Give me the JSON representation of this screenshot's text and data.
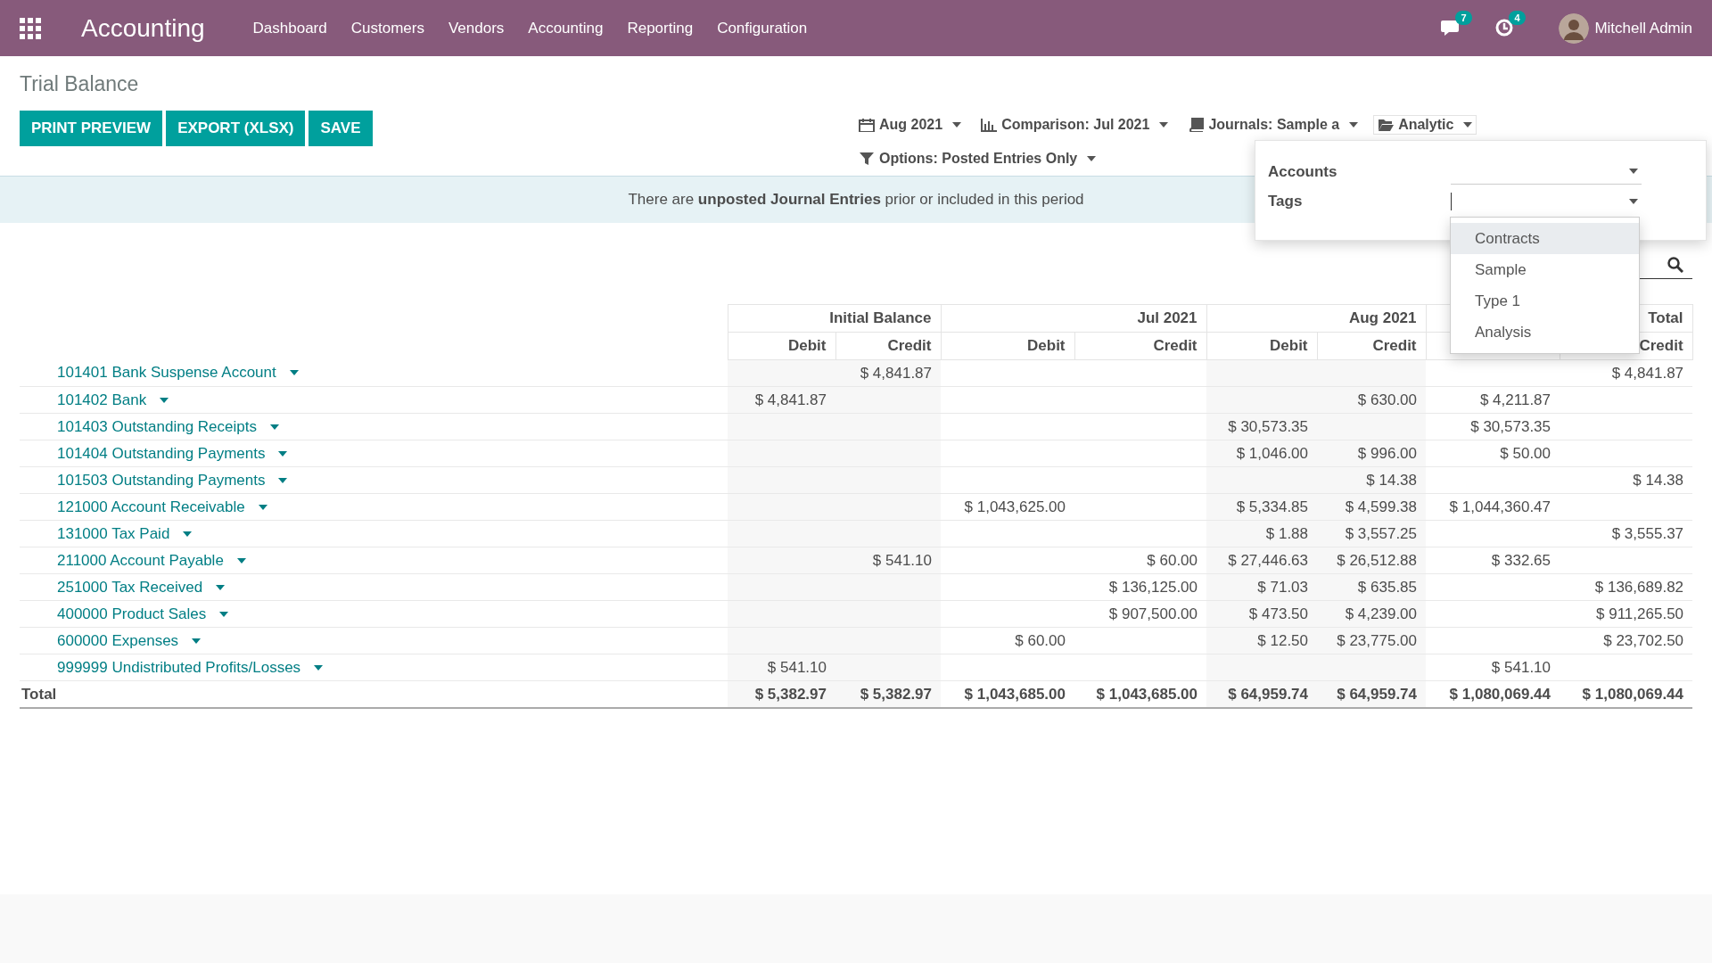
{
  "navbar": {
    "app_name": "Accounting",
    "menu": [
      "Dashboard",
      "Customers",
      "Vendors",
      "Accounting",
      "Reporting",
      "Configuration"
    ],
    "messages_count": "7",
    "activities_count": "4",
    "user": "Mitchell Admin"
  },
  "title": "Trial Balance",
  "buttons": [
    "PRINT PREVIEW",
    "EXPORT (XLSX)",
    "SAVE"
  ],
  "filters": [
    {
      "kind": "calendar",
      "label": "Aug 2021"
    },
    {
      "kind": "chart",
      "label": "Comparison: Jul 2021"
    },
    {
      "kind": "book",
      "label": "Journals: Sample a"
    },
    {
      "kind": "folder",
      "label": "Analytic",
      "expanded": true
    },
    {
      "kind": "funnel",
      "label": "Options: Posted Entries Only"
    }
  ],
  "banner": "There are **unposted Journal Entries** prior or included in this period",
  "analytic_panel": {
    "fields": [
      {
        "label": "Accounts",
        "focused": false
      },
      {
        "label": "Tags",
        "focused": true
      }
    ],
    "options": [
      {
        "label": "Contracts",
        "selected": true
      },
      {
        "label": "Sample",
        "selected": false
      },
      {
        "label": "Type 1",
        "selected": false
      },
      {
        "label": "Analysis",
        "selected": false
      }
    ]
  },
  "table": {
    "groups": [
      {
        "label": "Initial Balance",
        "columns": [
          "Debit",
          "Credit"
        ]
      },
      {
        "label": "Jul 2021",
        "columns": [
          "Debit",
          "Credit"
        ]
      },
      {
        "label": "Aug 2021",
        "columns": [
          "Debit",
          "Credit"
        ]
      },
      {
        "label": "Total",
        "columns": [
          "Credit"
        ]
      }
    ],
    "rows": [
      {
        "account": "101401 Bank Suspense Account",
        "values": {
          "initial_credit": "$ 4,841.87",
          "total_credit": "$ 4,841.87"
        }
      },
      {
        "account": "101402 Bank",
        "values": {
          "initial_debit": "$ 4,841.87",
          "aug_credit": "$ 630.00",
          "total_debit": "$ 4,211.87"
        }
      },
      {
        "account": "101403 Outstanding Receipts",
        "values": {
          "aug_debit": "$ 30,573.35",
          "total_debit": "$ 30,573.35"
        }
      },
      {
        "account": "101404 Outstanding Payments",
        "values": {
          "aug_debit": "$ 1,046.00",
          "aug_credit": "$ 996.00",
          "total_debit": "$ 50.00"
        }
      },
      {
        "account": "101503 Outstanding Payments",
        "values": {
          "aug_credit": "$ 14.38",
          "total_credit": "$ 14.38"
        }
      },
      {
        "account": "121000 Account Receivable",
        "values": {
          "jul_debit": "$ 1,043,625.00",
          "aug_debit": "$ 5,334.85",
          "aug_credit": "$ 4,599.38",
          "total_debit": "$ 1,044,360.47"
        }
      },
      {
        "account": "131000 Tax Paid",
        "values": {
          "aug_debit": "$ 1.88",
          "aug_credit": "$ 3,557.25",
          "total_credit": "$ 3,555.37"
        }
      },
      {
        "account": "211000 Account Payable",
        "values": {
          "initial_credit": "$ 541.10",
          "jul_credit": "$ 60.00",
          "aug_debit": "$ 27,446.63",
          "aug_credit": "$ 26,512.88",
          "total_debit": "$ 332.65"
        }
      },
      {
        "account": "251000 Tax Received",
        "values": {
          "jul_credit": "$ 136,125.00",
          "aug_debit": "$ 71.03",
          "aug_credit": "$ 635.85",
          "total_credit": "$ 136,689.82"
        }
      },
      {
        "account": "400000 Product Sales",
        "values": {
          "jul_credit": "$ 907,500.00",
          "aug_debit": "$ 473.50",
          "aug_credit": "$ 4,239.00",
          "total_credit": "$ 911,265.50"
        }
      },
      {
        "account": "600000 Expenses",
        "values": {
          "jul_debit": "$ 60.00",
          "aug_debit": "$ 12.50",
          "aug_credit": "$ 23,775.00",
          "total_credit": "$ 23,702.50"
        }
      },
      {
        "account": "999999 Undistributed Profits/Losses",
        "values": {
          "initial_debit": "$ 541.10",
          "total_debit": "$ 541.10"
        }
      }
    ],
    "total": {
      "label": "Total",
      "values": {
        "initial_debit": "$ 5,382.97",
        "initial_credit": "$ 5,382.97",
        "jul_debit": "$ 1,043,685.00",
        "jul_credit": "$ 1,043,685.00",
        "aug_debit": "$ 64,959.74",
        "aug_credit": "$ 64,959.74",
        "total_debit": "$ 1,080,069.44",
        "total_credit": "$ 1,080,069.44"
      }
    }
  }
}
